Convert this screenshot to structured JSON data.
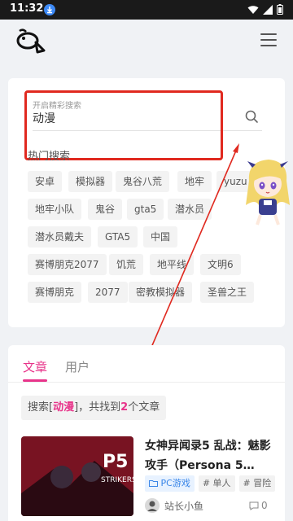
{
  "status_bar": {
    "time": "11:32"
  },
  "search": {
    "label": "开启精彩搜索",
    "value": "动漫",
    "hot_title": "热门搜索",
    "hot_tags": [
      "安卓",
      "模拟器",
      "鬼谷八荒",
      "地牢",
      "yuzu",
      "地牢小队",
      "鬼谷",
      "gta5",
      "潜水员",
      "潜水员戴夫",
      "GTA5",
      "中国",
      "赛博朋克2077",
      "饥荒",
      "地平线",
      "文明6",
      "赛博朋克",
      "2077",
      "密教模拟器",
      "圣兽之王"
    ]
  },
  "tabs": {
    "articles": "文章",
    "users": "用户"
  },
  "result": {
    "prefix": "搜索[",
    "keyword": "动漫",
    "middle": "]，共找到",
    "count": "2",
    "suffix": "个文章"
  },
  "article": {
    "title": "女神异闻录5 乱战：魅影攻手（Persona 5…",
    "category": "PC游戏",
    "tags": [
      "# 单人",
      "# 冒险"
    ],
    "author": "站长小鱼",
    "comments": "0"
  },
  "colors": {
    "accent": "#e8348a",
    "highlight_box": "#e0291f",
    "category_blue": "#3a86e8"
  }
}
